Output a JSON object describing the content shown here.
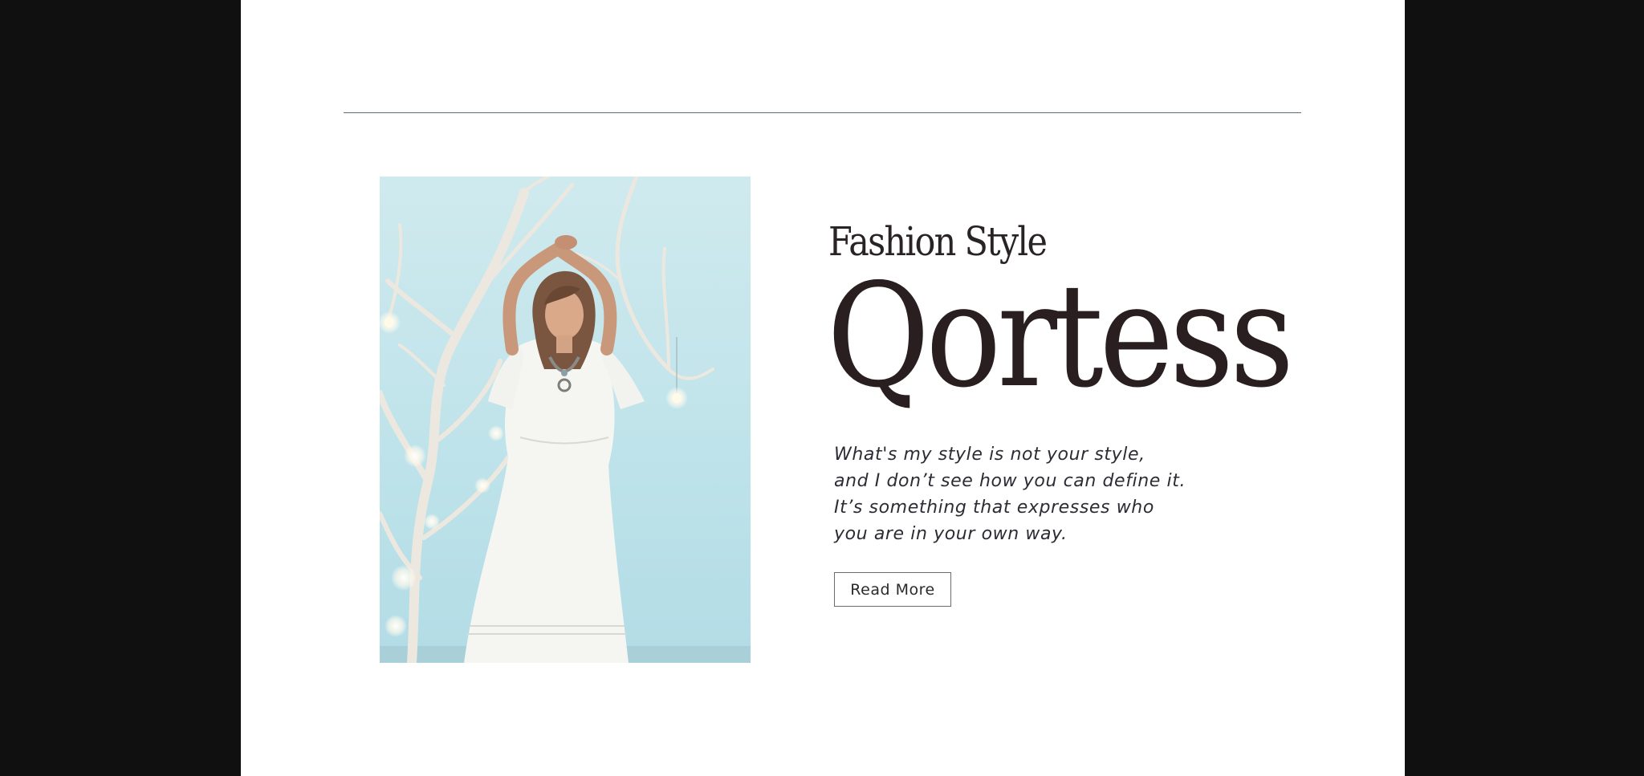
{
  "hero": {
    "kicker": "Fashion Style",
    "headline": "Qortess",
    "body_lines": [
      "What's my style is not your style,",
      "and I don’t see how you can define it.",
      "It’s something that expresses who",
      "you are in your own way."
    ],
    "cta_label": "Read More",
    "photo_icon": "woman-in-white-dress-photo"
  },
  "colors": {
    "side_background": "#101010",
    "page_background": "#ffffff",
    "text_dark": "#2a1f20",
    "rule": "#5f6a73",
    "photo_sky": "#c4e5eb"
  }
}
